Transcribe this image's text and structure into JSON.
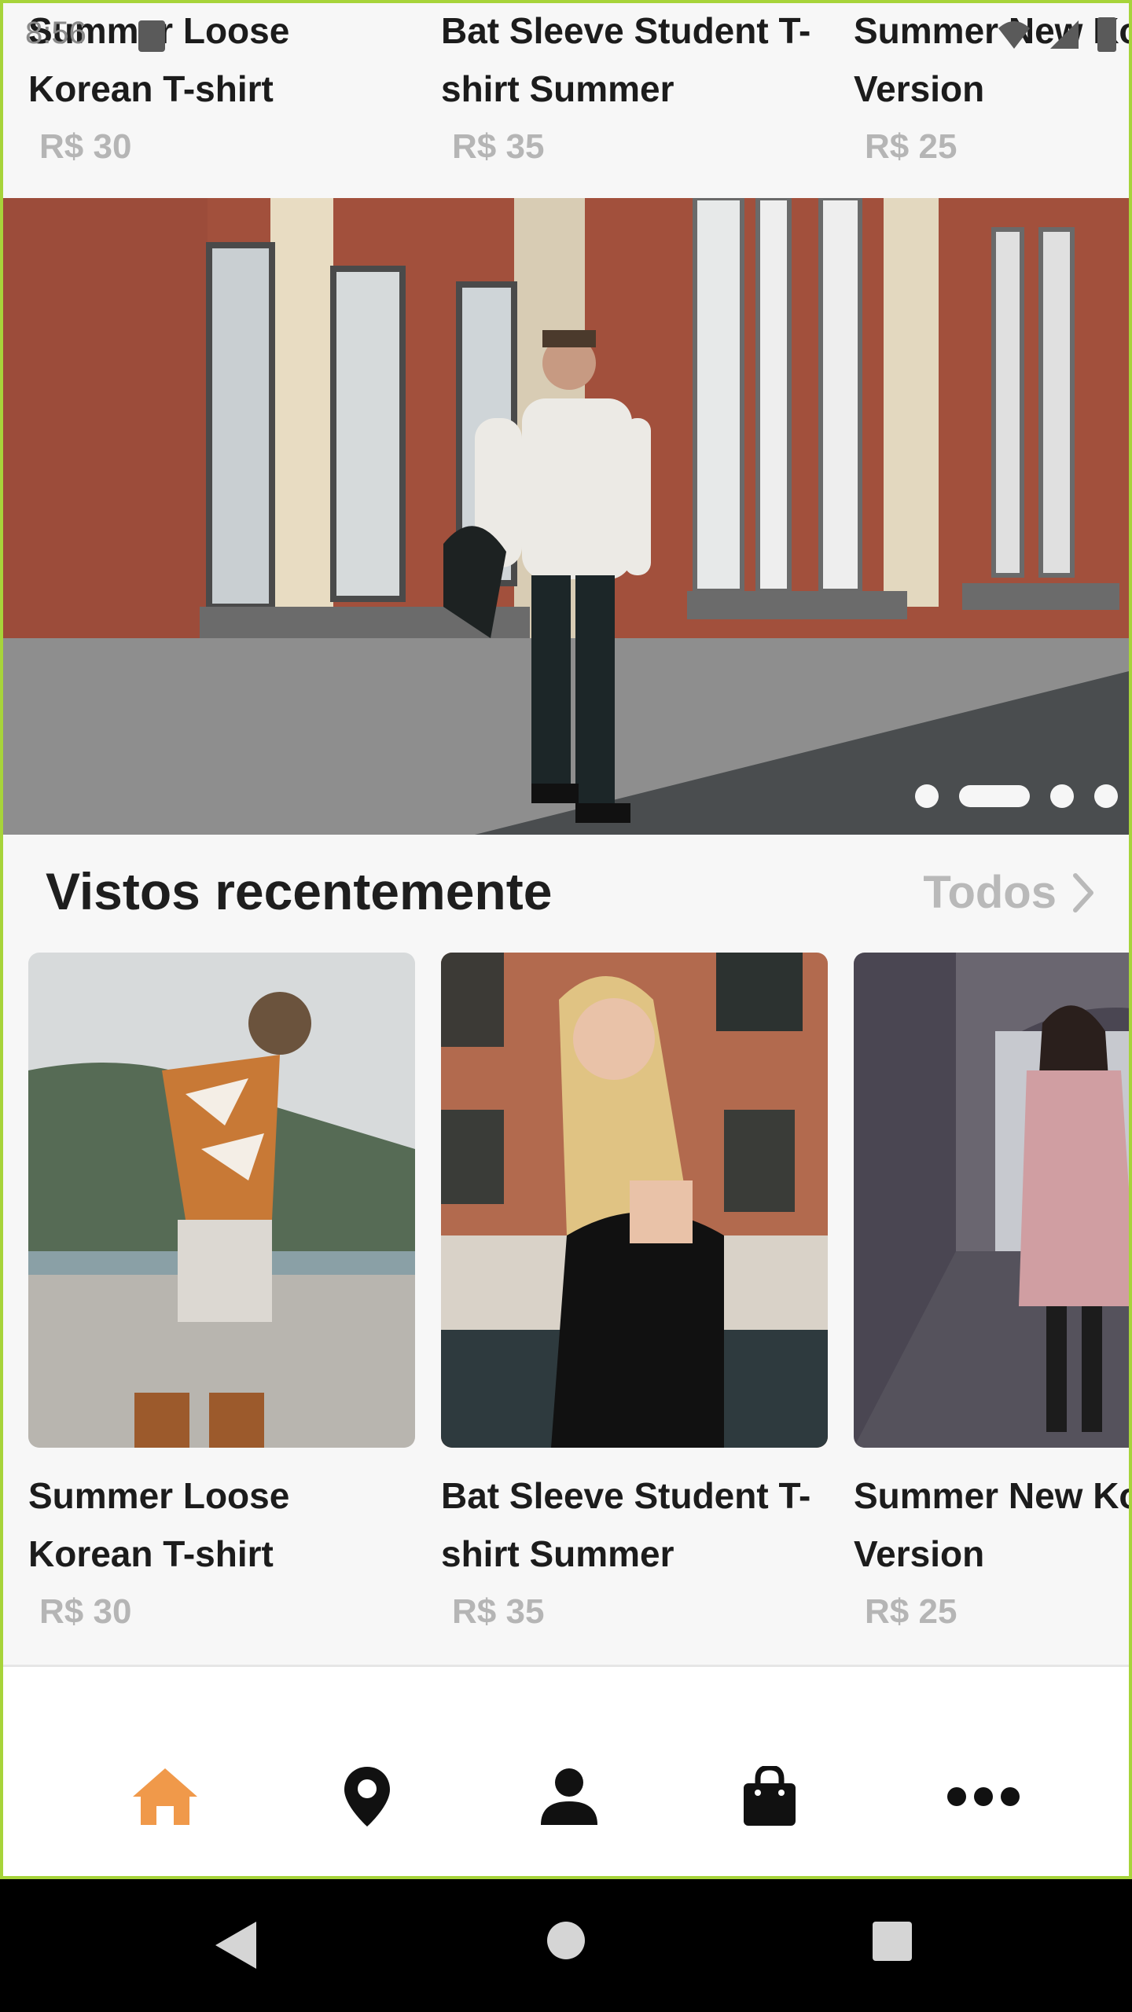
{
  "status_bar": {
    "time": "8:56"
  },
  "top_products": [
    {
      "name_line1": "Summer Loose",
      "name_line2": "Korean T-shirt",
      "price": "R$ 30"
    },
    {
      "name_line1": "Bat Sleeve Student T-",
      "name_line2": "shirt Summer",
      "price": "R$ 35"
    },
    {
      "name_line1": "Summer New Ko",
      "name_line2": "Version",
      "price": "R$ 25"
    }
  ],
  "banner": {
    "slide_count": 4,
    "active_slide": 2
  },
  "recent_section": {
    "title": "Vistos recentemente",
    "see_all_label": "Todos"
  },
  "recent_products": [
    {
      "name_line1": "Summer Loose",
      "name_line2": "Korean T-shirt",
      "price": "R$ 30"
    },
    {
      "name_line1": "Bat Sleeve Student T-",
      "name_line2": "shirt Summer",
      "price": "R$ 35"
    },
    {
      "name_line1": "Summer New Ko",
      "name_line2": "Version",
      "price": "R$ 25"
    }
  ],
  "bottom_nav": {
    "items": [
      "home-icon",
      "location-pin-icon",
      "user-icon",
      "shopping-bag-icon",
      "more-dots-icon"
    ],
    "active": "home-icon",
    "active_color": "#f0994a",
    "inactive_color": "#111111"
  },
  "colors": {
    "frame_border": "#a7d43a",
    "price_gray": "#b5b5b5",
    "background": "#f7f7f7"
  }
}
